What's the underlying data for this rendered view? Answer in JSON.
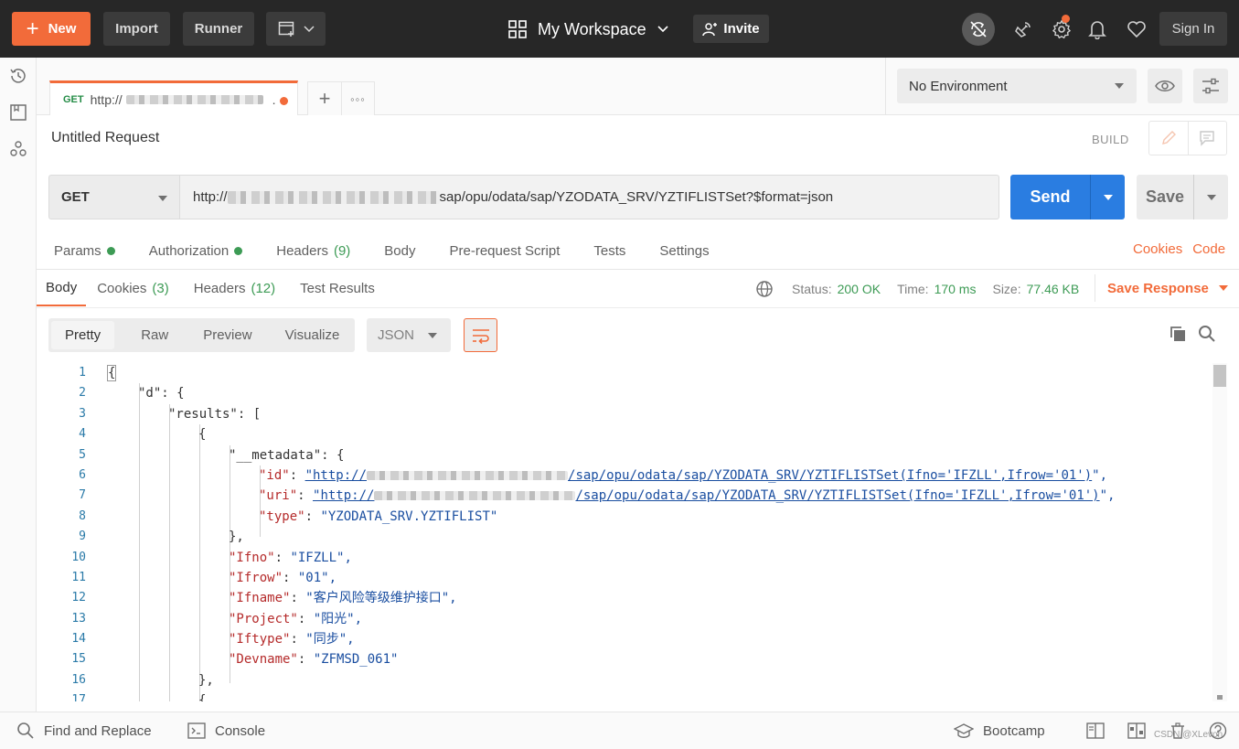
{
  "topbar": {
    "new_label": "New",
    "import_label": "Import",
    "runner_label": "Runner",
    "workspace_label": "My Workspace",
    "invite_label": "Invite",
    "signin_label": "Sign In",
    "accent": "#f26b3a"
  },
  "tab": {
    "method": "GET",
    "url_prefix": "http://",
    "url_suffix": "."
  },
  "environment": {
    "selected": "No Environment"
  },
  "request": {
    "title": "Untitled Request",
    "build_label": "BUILD",
    "method": "GET",
    "url_prefix": "http://",
    "url_suffix": "sap/opu/odata/sap/YZODATA_SRV/YZTIFLISTSet?$format=json",
    "send_label": "Send",
    "save_label": "Save"
  },
  "request_tabs": [
    {
      "label": "Params",
      "dot": true
    },
    {
      "label": "Authorization",
      "dot": true
    },
    {
      "label": "Headers",
      "count": "(9)"
    },
    {
      "label": "Body"
    },
    {
      "label": "Pre-request Script"
    },
    {
      "label": "Tests"
    },
    {
      "label": "Settings"
    }
  ],
  "request_links": {
    "cookies": "Cookies",
    "code": "Code"
  },
  "response_tabs": [
    {
      "label": "Body",
      "active": true
    },
    {
      "label": "Cookies",
      "count": "(3)"
    },
    {
      "label": "Headers",
      "count": "(12)"
    },
    {
      "label": "Test Results"
    }
  ],
  "status": {
    "status_label": "Status:",
    "status_value": "200 OK",
    "time_label": "Time:",
    "time_value": "170 ms",
    "size_label": "Size:",
    "size_value": "77.46 KB",
    "save_response_label": "Save Response"
  },
  "view_options": [
    "Pretty",
    "Raw",
    "Preview",
    "Visualize"
  ],
  "format": "JSON",
  "code_lines": [
    {
      "n": "1",
      "text": "{"
    },
    {
      "n": "2",
      "text": "\"d\": {"
    },
    {
      "n": "3",
      "text": "\"results\": ["
    },
    {
      "n": "4",
      "text": "{"
    },
    {
      "n": "5",
      "text": "\"__metadata\": {"
    },
    {
      "n": "6",
      "key": "\"id\"",
      "link_prefix": "\"http://",
      "link_suffix": "/sap/opu/odata/sap/YZODATA_SRV/YZTIFLISTSet(Ifno='IFZLL',Ifrow='01')",
      "tail": "\","
    },
    {
      "n": "7",
      "key": "\"uri\"",
      "link_prefix": "\"http://",
      "link_suffix": "/sap/opu/odata/sap/YZODATA_SRV/YZTIFLISTSet(Ifno='IFZLL',Ifrow='01')",
      "tail": "\","
    },
    {
      "n": "8",
      "key": "\"type\"",
      "value": "\"YZODATA_SRV.YZTIFLIST\""
    },
    {
      "n": "9",
      "text": "},"
    },
    {
      "n": "10",
      "key": "\"Ifno\"",
      "value": "\"IFZLL\","
    },
    {
      "n": "11",
      "key": "\"Ifrow\"",
      "value": "\"01\","
    },
    {
      "n": "12",
      "key": "\"Ifname\"",
      "value": "\"客户风险等级维护接口\","
    },
    {
      "n": "13",
      "key": "\"Project\"",
      "value": "\"阳光\","
    },
    {
      "n": "14",
      "key": "\"Iftype\"",
      "value": "\"同步\","
    },
    {
      "n": "15",
      "key": "\"Devname\"",
      "value": "\"ZFMSD_061\""
    },
    {
      "n": "16",
      "text": "},"
    },
    {
      "n": "17",
      "text": "{"
    }
  ],
  "footer": {
    "find_replace": "Find and Replace",
    "console": "Console",
    "bootcamp": "Bootcamp",
    "watermark": "CSDN @XLevon"
  }
}
